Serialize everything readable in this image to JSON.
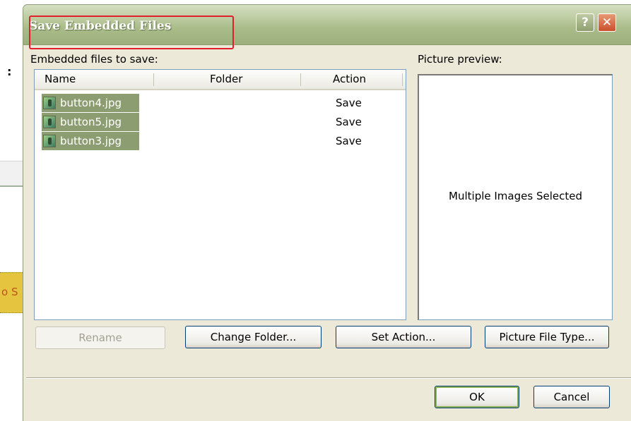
{
  "dialog": {
    "title": "Save Embedded Files",
    "help_glyph": "?",
    "close_glyph": "✕"
  },
  "background_app": {
    "colon": ":",
    "yellow_text": "o S"
  },
  "list": {
    "label": "Embedded files to save:",
    "columns": [
      "Name",
      "Folder",
      "Action"
    ],
    "rows": [
      {
        "name": "button4.jpg",
        "folder": "",
        "action": "Save",
        "icon": "image-file-icon"
      },
      {
        "name": "button5.jpg",
        "folder": "",
        "action": "Save",
        "icon": "image-file-icon"
      },
      {
        "name": "button3.jpg",
        "folder": "",
        "action": "Save",
        "icon": "image-file-icon"
      }
    ]
  },
  "preview": {
    "label": "Picture preview:",
    "text": "Multiple Images Selected"
  },
  "buttons": {
    "rename": "Rename",
    "change_folder": "Change Folder...",
    "set_action": "Set Action...",
    "picture_file_type": "Picture File Type...",
    "ok": "OK",
    "cancel": "Cancel"
  },
  "colors": {
    "dialog_bg": "#ece9d8",
    "selection": "#8d9d72",
    "annotation_red": "#e3202a"
  }
}
